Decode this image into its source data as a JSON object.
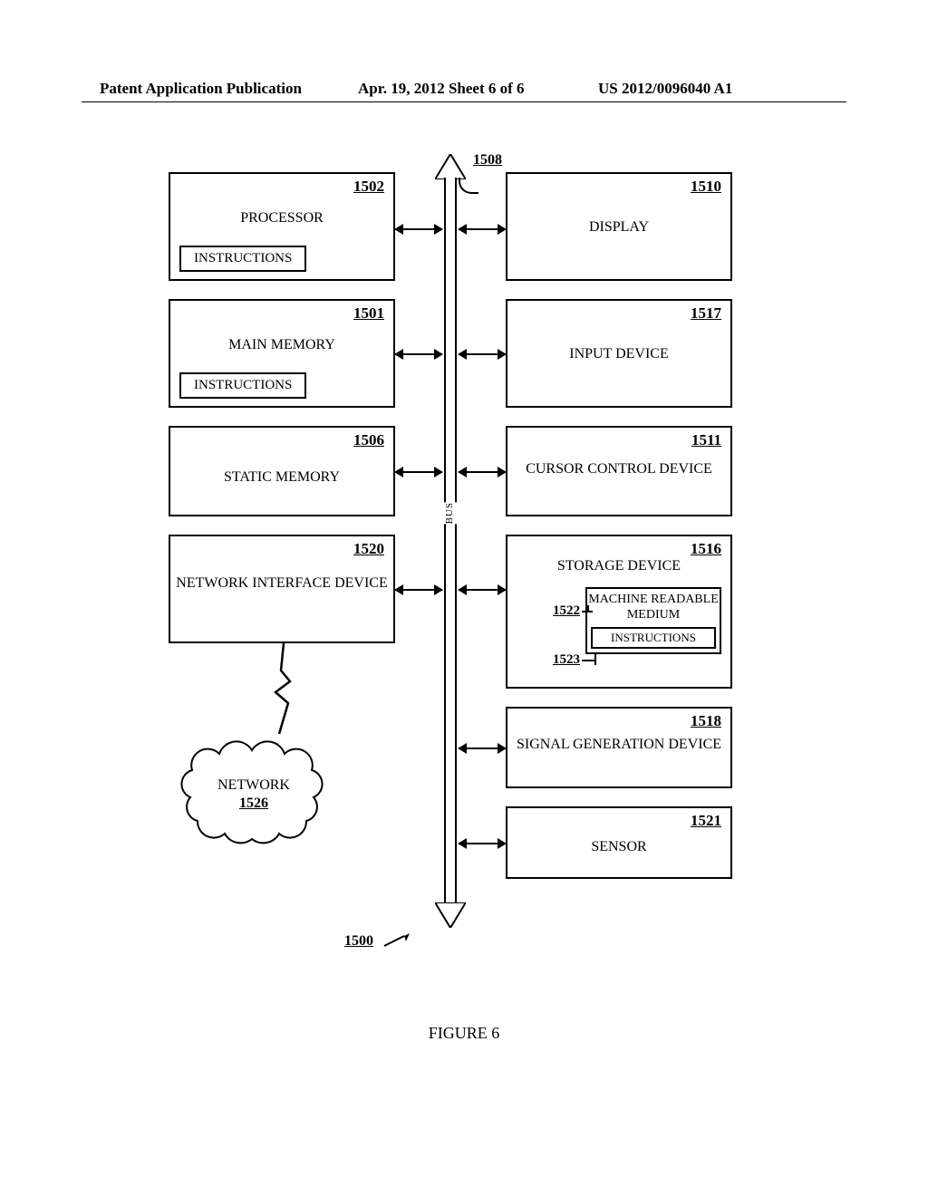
{
  "header": {
    "left": "Patent Application Publication",
    "mid": "Apr. 19, 2012  Sheet 6 of 6",
    "right": "US 2012/0096040 A1"
  },
  "bus": {
    "ref": "1508",
    "label": "BUS"
  },
  "blocks": {
    "processor": {
      "ref": "1502",
      "title": "PROCESSOR",
      "sub": "INSTRUCTIONS"
    },
    "mainmem": {
      "ref": "1501",
      "title": "MAIN MEMORY",
      "sub": "INSTRUCTIONS"
    },
    "staticmem": {
      "ref": "1506",
      "title": "STATIC MEMORY"
    },
    "nid": {
      "ref": "1520",
      "title": "NETWORK INTERFACE DEVICE"
    },
    "display": {
      "ref": "1510",
      "title": "DISPLAY"
    },
    "input": {
      "ref": "1517",
      "title": "INPUT DEVICE"
    },
    "cursor": {
      "ref": "1511",
      "title": "CURSOR CONTROL DEVICE"
    },
    "storage": {
      "ref": "1516",
      "title": "STORAGE DEVICE",
      "mrm_ref": "1522",
      "mrm": "MACHINE READABLE MEDIUM",
      "instr_ref": "1523",
      "instr": "INSTRUCTIONS"
    },
    "signal": {
      "ref": "1518",
      "title": "SIGNAL GENERATION DEVICE"
    },
    "sensor": {
      "ref": "1521",
      "title": "SENSOR"
    }
  },
  "network": {
    "label": "NETWORK",
    "ref": "1526"
  },
  "system_ref": "1500",
  "figure_caption": "FIGURE 6"
}
